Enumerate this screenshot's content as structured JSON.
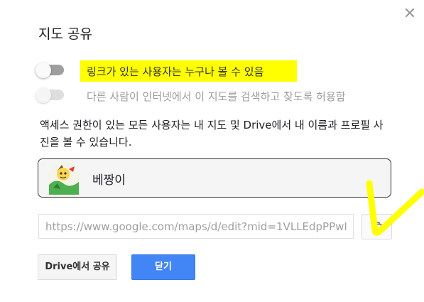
{
  "dialog": {
    "title": "지도 공유",
    "close_icon": "close-icon"
  },
  "options": [
    {
      "label": "링크가 있는 사용자는 누구나 볼 수 있음",
      "enabled": false,
      "highlighted": true
    },
    {
      "label": "다른 사람이 인터넷에서 이 지도를 검색하고 찾도록 허용함",
      "enabled": false,
      "disabled": true
    }
  ],
  "description": "액세스 권한이 있는 모든 사용자는 내 지도 및 Drive에서 내 이름과 프로필 사진을 볼 수 있습니다.",
  "owner": {
    "name": "베짱이",
    "avatar_icon": "avatar-icon"
  },
  "share_link": {
    "value": "https://www.google.com/maps/d/edit?mid=1VLLEdpPPwI",
    "copy_icon": "copy-icon"
  },
  "buttons": {
    "drive_share": "Drive에서 공유",
    "close": "닫기"
  },
  "colors": {
    "primary_button": "#4285f4",
    "highlight": "#ffff00"
  }
}
